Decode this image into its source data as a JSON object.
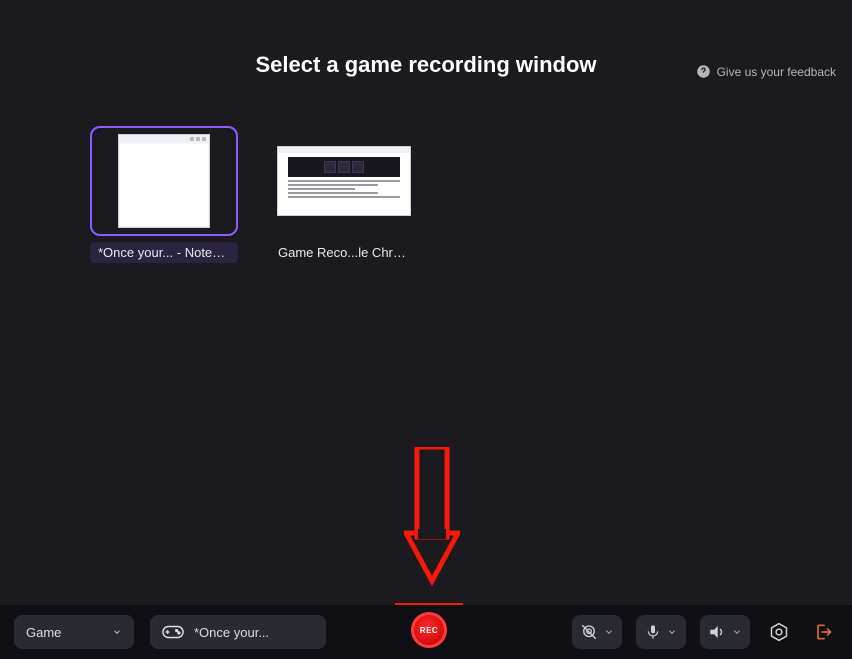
{
  "header": {
    "feedback_label": "Give us your feedback"
  },
  "main": {
    "title": "Select a game recording window",
    "thumbs": [
      {
        "label": "*Once your... - Notepad",
        "selected": true,
        "kind": "notepad"
      },
      {
        "label": "Game Reco...le Chrome",
        "selected": false,
        "kind": "chrome"
      }
    ]
  },
  "bottombar": {
    "mode_label": "Game",
    "window_label": "*Once your...",
    "rec_label": "REC"
  },
  "icons": {
    "help": "help-circle",
    "chevron_down": "chevron-down",
    "gamepad": "gamepad",
    "webcam_off": "webcam-off",
    "mic": "mic",
    "speaker": "speaker",
    "settings": "settings-hex",
    "exit": "exit"
  },
  "colors": {
    "accent": "#8f5cff",
    "record": "#ff2a2a",
    "annotation": "#f5180b"
  }
}
